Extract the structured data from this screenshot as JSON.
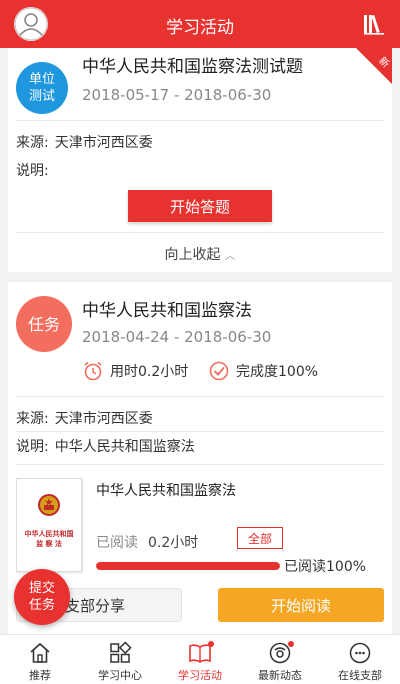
{
  "header": {
    "title": "学习活动",
    "avatar_icon": "user-avatar-icon",
    "library_icon": "library-icon"
  },
  "card1": {
    "badge": "单位\n测试",
    "ribbon": "新",
    "title": "中华人民共和国监察法测试题",
    "date": "2018-05-17 - 2018-06-30",
    "source_label": "来源:",
    "source_value": "天津市河西区委",
    "desc_label": "说明:",
    "desc_value": "",
    "action": "开始答题",
    "collapse": "向上收起",
    "collapse_icon": "chevron-up-icon"
  },
  "card2": {
    "badge": "任务",
    "title": "中华人民共和国监察法",
    "date": "2018-04-24 - 2018-06-30",
    "time_used": "用时0.2小时",
    "completion": "完成度100%",
    "source_label": "来源:",
    "source_value": "天津市河西区委",
    "desc_label": "说明:",
    "desc_value": "中华人民共和国监察法",
    "book": {
      "cover_text": "中华人民共和国\n监 察 法",
      "title": "中华人民共和国监察法",
      "read_label": "已阅读",
      "read_value": "0.2小时",
      "all_button": "全部",
      "progress_label": "已阅读100%",
      "progress": 1.0
    },
    "share_button": "支部分享",
    "read_button": "开始阅读"
  },
  "fab": {
    "label": "提交\n任务"
  },
  "nav": [
    {
      "label": "推荐",
      "icon": "home-icon",
      "active": false,
      "dot": false
    },
    {
      "label": "学习中心",
      "icon": "apps-icon",
      "active": false,
      "dot": false
    },
    {
      "label": "学习活动",
      "icon": "book-open-icon",
      "active": true,
      "dot": true
    },
    {
      "label": "最新动态",
      "icon": "news-icon",
      "active": false,
      "dot": true
    },
    {
      "label": "在线支部",
      "icon": "chat-icon",
      "active": false,
      "dot": false
    }
  ],
  "colors": {
    "brand": "#e8322f",
    "orange": "#f5a623",
    "blue_badge": "#1e97de",
    "coral_badge": "#f36e5e"
  }
}
